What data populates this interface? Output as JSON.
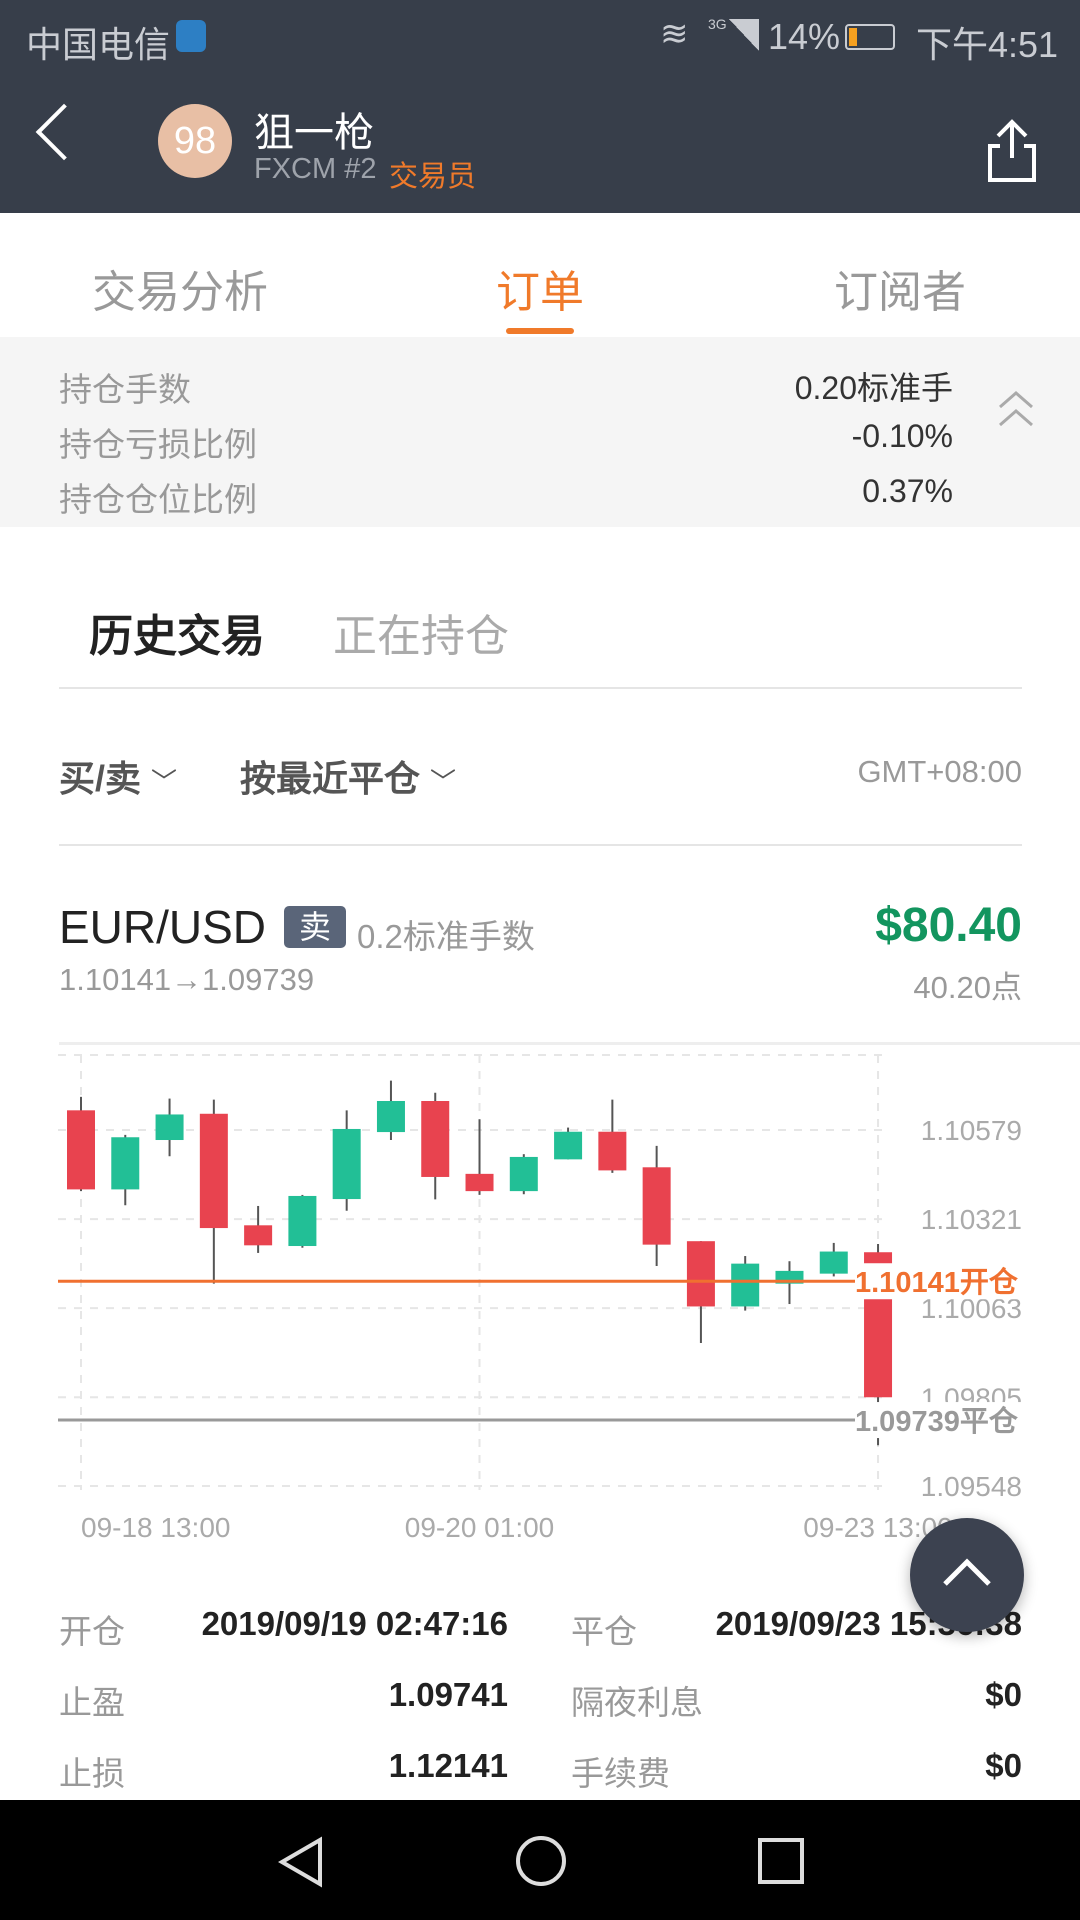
{
  "status_bar": {
    "carrier": "中国电信",
    "network": "3G",
    "battery": "14%",
    "battery_level": 14,
    "time": "下午4:51"
  },
  "header": {
    "avatar_score": "98",
    "name": "狙一枪",
    "broker": "FXCM #2",
    "role": "交易员",
    "role_color": "#f07a2a"
  },
  "tabs": [
    {
      "label": "交易分析",
      "active": false
    },
    {
      "label": "订单",
      "active": true
    },
    {
      "label": "订阅者",
      "active": false
    }
  ],
  "summary": [
    {
      "label": "持仓手数",
      "value": "0.20标准手"
    },
    {
      "label": "持仓亏损比例",
      "value": "-0.10%"
    },
    {
      "label": "持仓仓位比例",
      "value": "0.37%"
    }
  ],
  "subtabs": [
    {
      "label": "历史交易",
      "active": true
    },
    {
      "label": "正在持仓",
      "active": false
    }
  ],
  "filters": {
    "side": "买/卖",
    "sort": "按最近平仓",
    "timezone": "GMT+08:00"
  },
  "trade": {
    "symbol": "EUR/USD",
    "side": "卖",
    "lots": "0.2标准手数",
    "price_path": "1.10141→1.09739",
    "profit": "$80.40",
    "points": "40.20点",
    "profit_color": "#13955f"
  },
  "chart_data": {
    "type": "candlestick",
    "colors": {
      "up": "#22bf96",
      "down": "#e8434f"
    },
    "y_ticks": [
      "1.10579",
      "1.10321",
      "1.10063",
      "1.09805",
      "1.09548"
    ],
    "ylim": [
      1.0952,
      1.1075
    ],
    "x_ticks": [
      {
        "index": 0,
        "label": "09-18 13:00"
      },
      {
        "index": 9,
        "label": "09-20 01:00"
      },
      {
        "index": 18,
        "label": "09-23 13:00"
      }
    ],
    "candles": [
      {
        "o": 1.10636,
        "h": 1.10675,
        "l": 1.10402,
        "c": 1.10407
      },
      {
        "o": 1.10407,
        "h": 1.10565,
        "l": 1.10361,
        "c": 1.10558
      },
      {
        "o": 1.1055,
        "h": 1.1067,
        "l": 1.10503,
        "c": 1.10624
      },
      {
        "o": 1.10626,
        "h": 1.10667,
        "l": 1.10134,
        "c": 1.10295
      },
      {
        "o": 1.10303,
        "h": 1.10359,
        "l": 1.10223,
        "c": 1.10245
      },
      {
        "o": 1.10243,
        "h": 1.10391,
        "l": 1.10238,
        "c": 1.10388
      },
      {
        "o": 1.10379,
        "h": 1.10636,
        "l": 1.10345,
        "c": 1.10582
      },
      {
        "o": 1.10573,
        "h": 1.10722,
        "l": 1.1055,
        "c": 1.10663
      },
      {
        "o": 1.10663,
        "h": 1.10687,
        "l": 1.10378,
        "c": 1.10443
      },
      {
        "o": 1.10452,
        "h": 1.1061,
        "l": 1.10391,
        "c": 1.10402
      },
      {
        "o": 1.10402,
        "h": 1.10509,
        "l": 1.10393,
        "c": 1.10501
      },
      {
        "o": 1.10494,
        "h": 1.10586,
        "l": 1.10494,
        "c": 1.10574
      },
      {
        "o": 1.10574,
        "h": 1.10667,
        "l": 1.10455,
        "c": 1.10462
      },
      {
        "o": 1.10471,
        "h": 1.10533,
        "l": 1.10185,
        "c": 1.10247
      },
      {
        "o": 1.10257,
        "h": 1.10257,
        "l": 1.09962,
        "c": 1.10068
      },
      {
        "o": 1.10068,
        "h": 1.10214,
        "l": 1.10056,
        "c": 1.10192
      },
      {
        "o": 1.10134,
        "h": 1.10199,
        "l": 1.10075,
        "c": 1.10171
      },
      {
        "o": 1.10163,
        "h": 1.10252,
        "l": 1.10155,
        "c": 1.10227
      },
      {
        "o": 1.10225,
        "h": 1.10249,
        "l": 1.09666,
        "c": 1.09805
      }
    ],
    "lines": [
      {
        "value": 1.10141,
        "label": "1.10141开仓",
        "color": "#f07030"
      },
      {
        "value": 1.09739,
        "label": "1.09739平仓",
        "color": "#999999"
      }
    ]
  },
  "details": [
    {
      "label": "开仓",
      "value": "2019/09/19 02:47:16",
      "label2": "平仓",
      "value2": "2019/09/23 15:36:38"
    },
    {
      "label": "止盈",
      "value": "1.09741",
      "label2": "隔夜利息",
      "value2": "$0"
    },
    {
      "label": "止损",
      "value": "1.12141",
      "label2": "手续费",
      "value2": "$0"
    }
  ]
}
